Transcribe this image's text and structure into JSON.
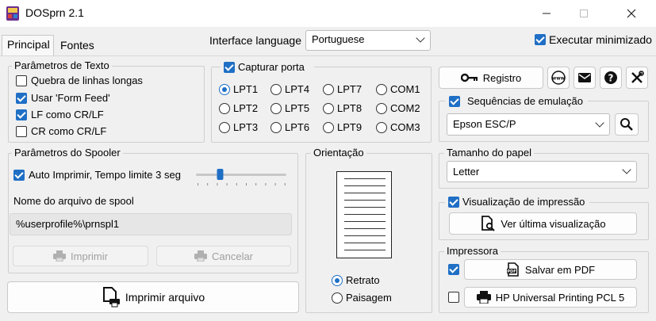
{
  "window": {
    "title": "DOSprn 2.1"
  },
  "tabs": [
    {
      "label": "Principal"
    },
    {
      "label": "Fontes"
    }
  ],
  "interface_language": {
    "label": "Interface language",
    "value": "Portuguese"
  },
  "executar_minimizado": {
    "label": "Executar minimizado",
    "checked": true
  },
  "parametros_texto": {
    "title": "Parâmetros de Texto",
    "options": [
      {
        "label": "Quebra de linhas longas",
        "checked": false
      },
      {
        "label": "Usar 'Form Feed'",
        "checked": true
      },
      {
        "label": "LF como CR/LF",
        "checked": true
      },
      {
        "label": "CR como CR/LF",
        "checked": false
      }
    ]
  },
  "capturar_porta": {
    "label": "Capturar porta",
    "checked": true,
    "ports": [
      "LPT1",
      "LPT4",
      "LPT7",
      "COM1",
      "LPT2",
      "LPT5",
      "LPT8",
      "COM2",
      "LPT3",
      "LPT6",
      "LPT9",
      "COM3"
    ],
    "selected": "LPT1"
  },
  "toolbar": {
    "registro_label": "Registro"
  },
  "emulacao": {
    "label": "Sequências de emulação",
    "checked": true,
    "value": "Epson ESC/P"
  },
  "spooler": {
    "title": "Parâmetros do Spooler",
    "auto_label": "Auto Imprimir, Tempo limite 3 seg",
    "auto_checked": true,
    "slider_level": 0.25,
    "spool_name_label": "Nome do arquivo de spool",
    "spool_name_value": "%userprofile%\\prnspl1",
    "imprimir_label": "Imprimir",
    "cancelar_label": "Cancelar"
  },
  "imprimir_arquivo_label": "Imprimir arquivo",
  "orientacao": {
    "title": "Orientação",
    "retrato": "Retrato",
    "paisagem": "Paisagem",
    "selected": "Retrato"
  },
  "tamanho_papel": {
    "title": "Tamanho do papel",
    "value": "Letter"
  },
  "visualizacao": {
    "label": "Visualização de impressão",
    "checked": true,
    "ver_label": "Ver última visualização"
  },
  "impressora": {
    "title": "Impressora",
    "pdf_checked": true,
    "pdf_label": "Salvar em PDF",
    "printer_checked": false,
    "printer_label": "HP Universal Printing PCL 5"
  },
  "colors": {
    "accent": "#1f6fc5",
    "disabled_text": "#a0a0a0"
  }
}
